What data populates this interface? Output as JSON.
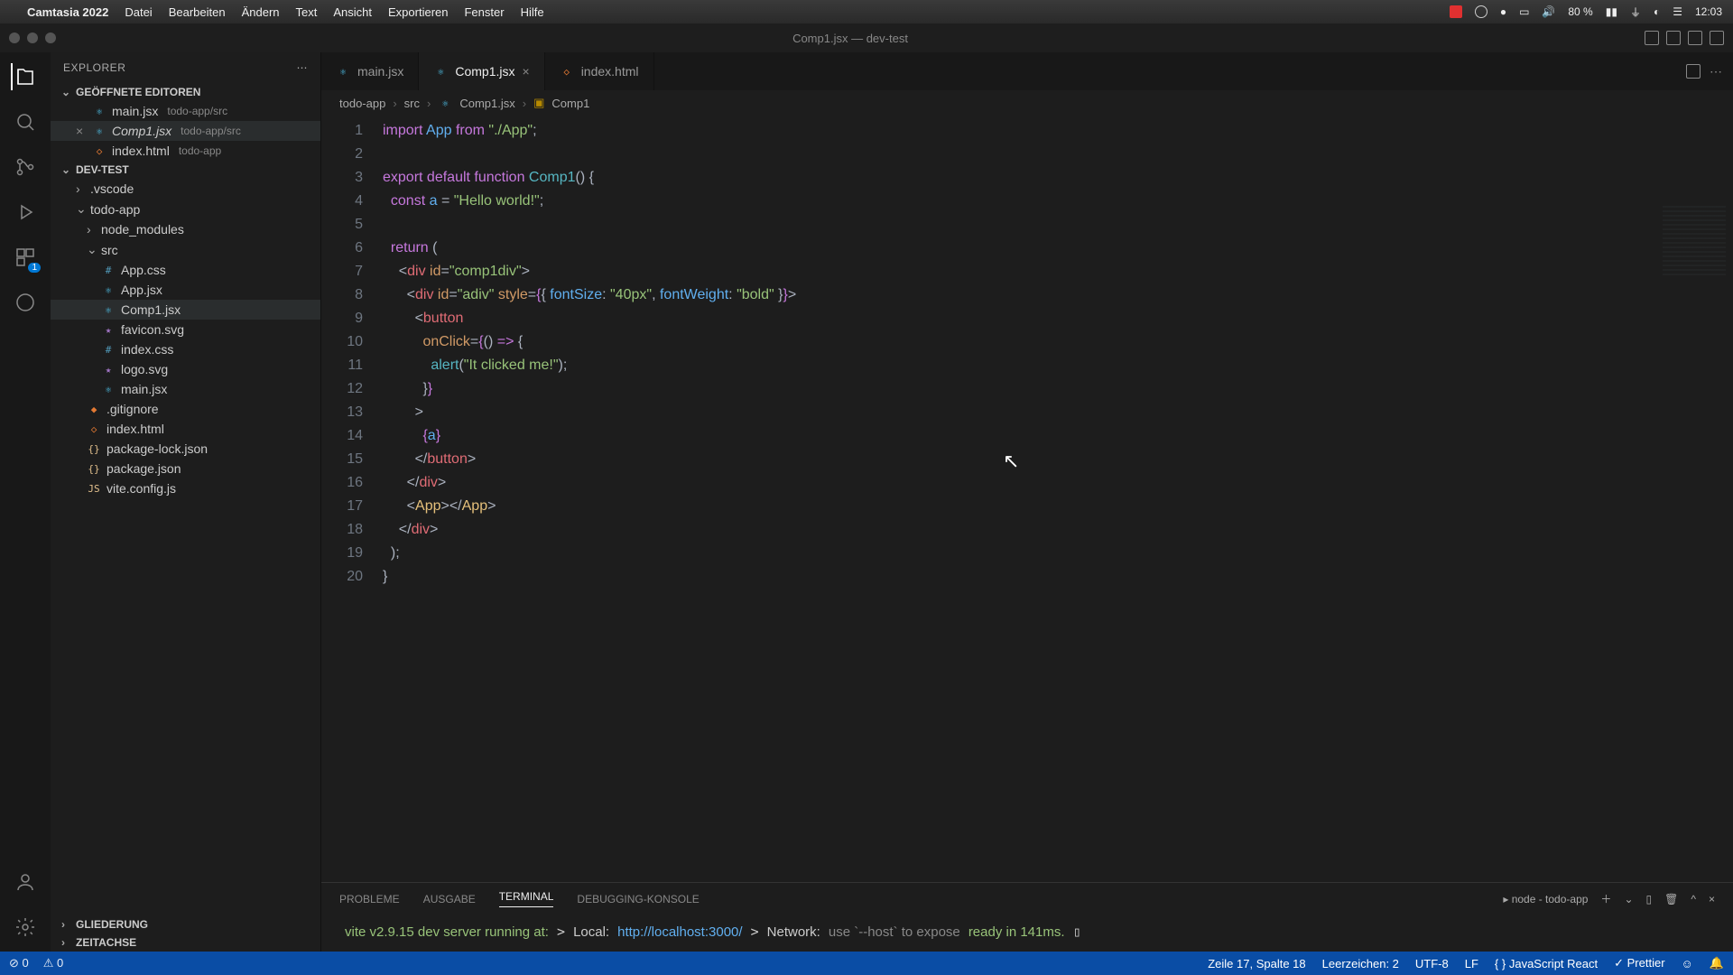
{
  "mac": {
    "app": "Camtasia 2022",
    "menus": [
      "Datei",
      "Bearbeiten",
      "Ändern",
      "Text",
      "Ansicht",
      "Exportieren",
      "Fenster",
      "Hilfe"
    ],
    "battery": "80 %",
    "clock": "12:03"
  },
  "window": {
    "title": "Comp1.jsx — dev-test"
  },
  "explorer": {
    "title": "EXPLORER",
    "open_editors_label": "GEÖFFNETE EDITOREN",
    "open_editors": [
      {
        "name": "main.jsx",
        "path": "todo-app/src"
      },
      {
        "name": "Comp1.jsx",
        "path": "todo-app/src",
        "active": true
      },
      {
        "name": "index.html",
        "path": "todo-app"
      }
    ],
    "workspace": "DEV-TEST",
    "outline": "GLIEDERUNG",
    "timeline": "ZEITACHSE",
    "tree": {
      "vscode": ".vscode",
      "todoapp": "todo-app",
      "node_modules": "node_modules",
      "src": "src",
      "files_src": [
        "App.css",
        "App.jsx",
        "Comp1.jsx",
        "favicon.svg",
        "index.css",
        "logo.svg",
        "main.jsx"
      ],
      "files_root": [
        ".gitignore",
        "index.html",
        "package-lock.json",
        "package.json",
        "vite.config.js"
      ]
    }
  },
  "tabs": [
    {
      "name": "main.jsx"
    },
    {
      "name": "Comp1.jsx",
      "active": true
    },
    {
      "name": "index.html"
    }
  ],
  "breadcrumbs": [
    "todo-app",
    "src",
    "Comp1.jsx",
    "Comp1"
  ],
  "code": {
    "lines": 20
  },
  "panel": {
    "tabs": [
      "PROBLEME",
      "AUSGABE",
      "TERMINAL",
      "DEBUGGING-KONSOLE"
    ],
    "task": "node - todo-app",
    "term1": "vite v2.9.15 dev server running at:",
    "local_label": "Local:",
    "local_url": "http://localhost:3000/",
    "network_label": "Network:",
    "network_hint": "use `--host` to expose",
    "ready": "ready in 141ms."
  },
  "status": {
    "errors": "0",
    "warnings": "0",
    "pos": "Zeile 17, Spalte 18",
    "spaces": "Leerzeichen: 2",
    "enc": "UTF-8",
    "eol": "LF",
    "lang": "JavaScript React",
    "prettier": "Prettier"
  },
  "activity_badge": "1"
}
